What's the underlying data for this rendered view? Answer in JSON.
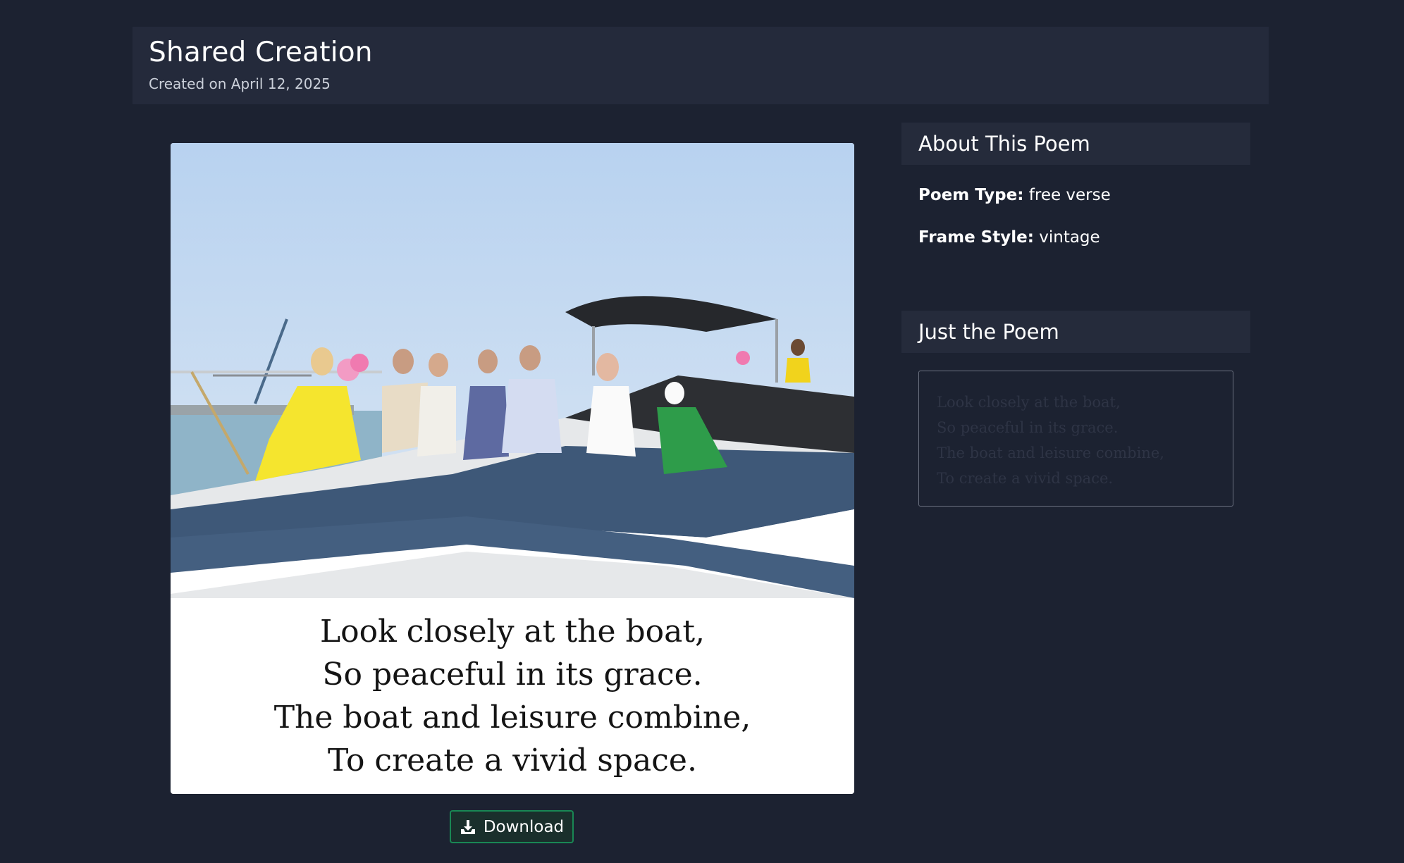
{
  "header": {
    "title": "Shared Creation",
    "subtitle": "Created on April 12, 2025"
  },
  "creation": {
    "image_description_icon": "photo-boat-group",
    "poem_lines": [
      "Look closely at the boat,",
      "So peaceful in its grace.",
      "The boat and leisure combine,",
      "To create a vivid space."
    ],
    "download_label": "Download",
    "download_icon": "download-icon"
  },
  "about": {
    "title": "About This Poem",
    "poem_type_label": "Poem Type:",
    "poem_type_value": "free verse",
    "frame_style_label": "Frame Style:",
    "frame_style_value": "vintage"
  },
  "just_poem": {
    "title": "Just the Poem",
    "lines": [
      "Look closely at the boat,",
      "So peaceful in its grace.",
      "The boat and leisure combine,",
      "To create a vivid space."
    ]
  },
  "colors": {
    "background": "#1c2231",
    "panel": "#242a3b",
    "download_border": "#198754"
  }
}
